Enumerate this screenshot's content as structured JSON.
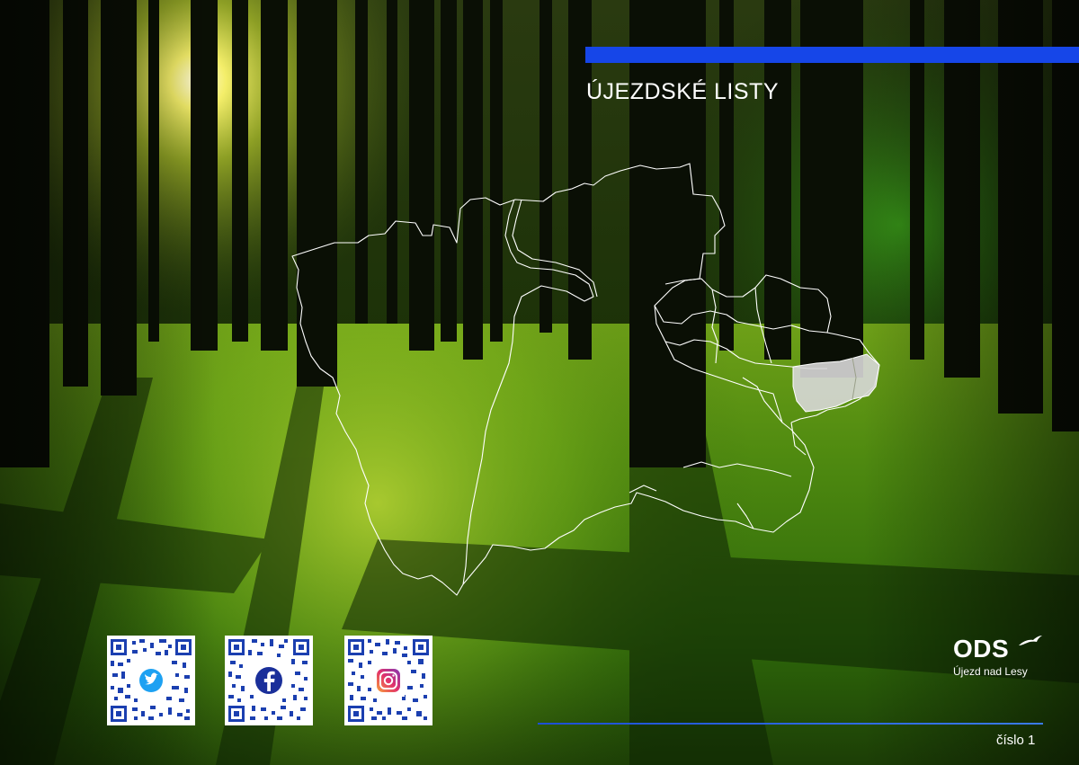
{
  "cover": {
    "title": "ÚJEZDSKÉ LISTY",
    "issue": "číslo 1",
    "background": "forest-photo"
  },
  "logo": {
    "name": "ODS",
    "subtitle": "Újezd nad Lesy"
  },
  "qr_codes": [
    {
      "icon": "twitter-icon",
      "color": "#1da1f2"
    },
    {
      "icon": "facebook-icon",
      "color": "#1a2f9a"
    },
    {
      "icon": "instagram-icon",
      "color": "#e1306c"
    }
  ],
  "colors": {
    "accent_blue": "#1646e8",
    "qr_blue": "#1b3fb0",
    "map_outline": "#ffffff",
    "map_highlight": "#d8d8d8"
  }
}
